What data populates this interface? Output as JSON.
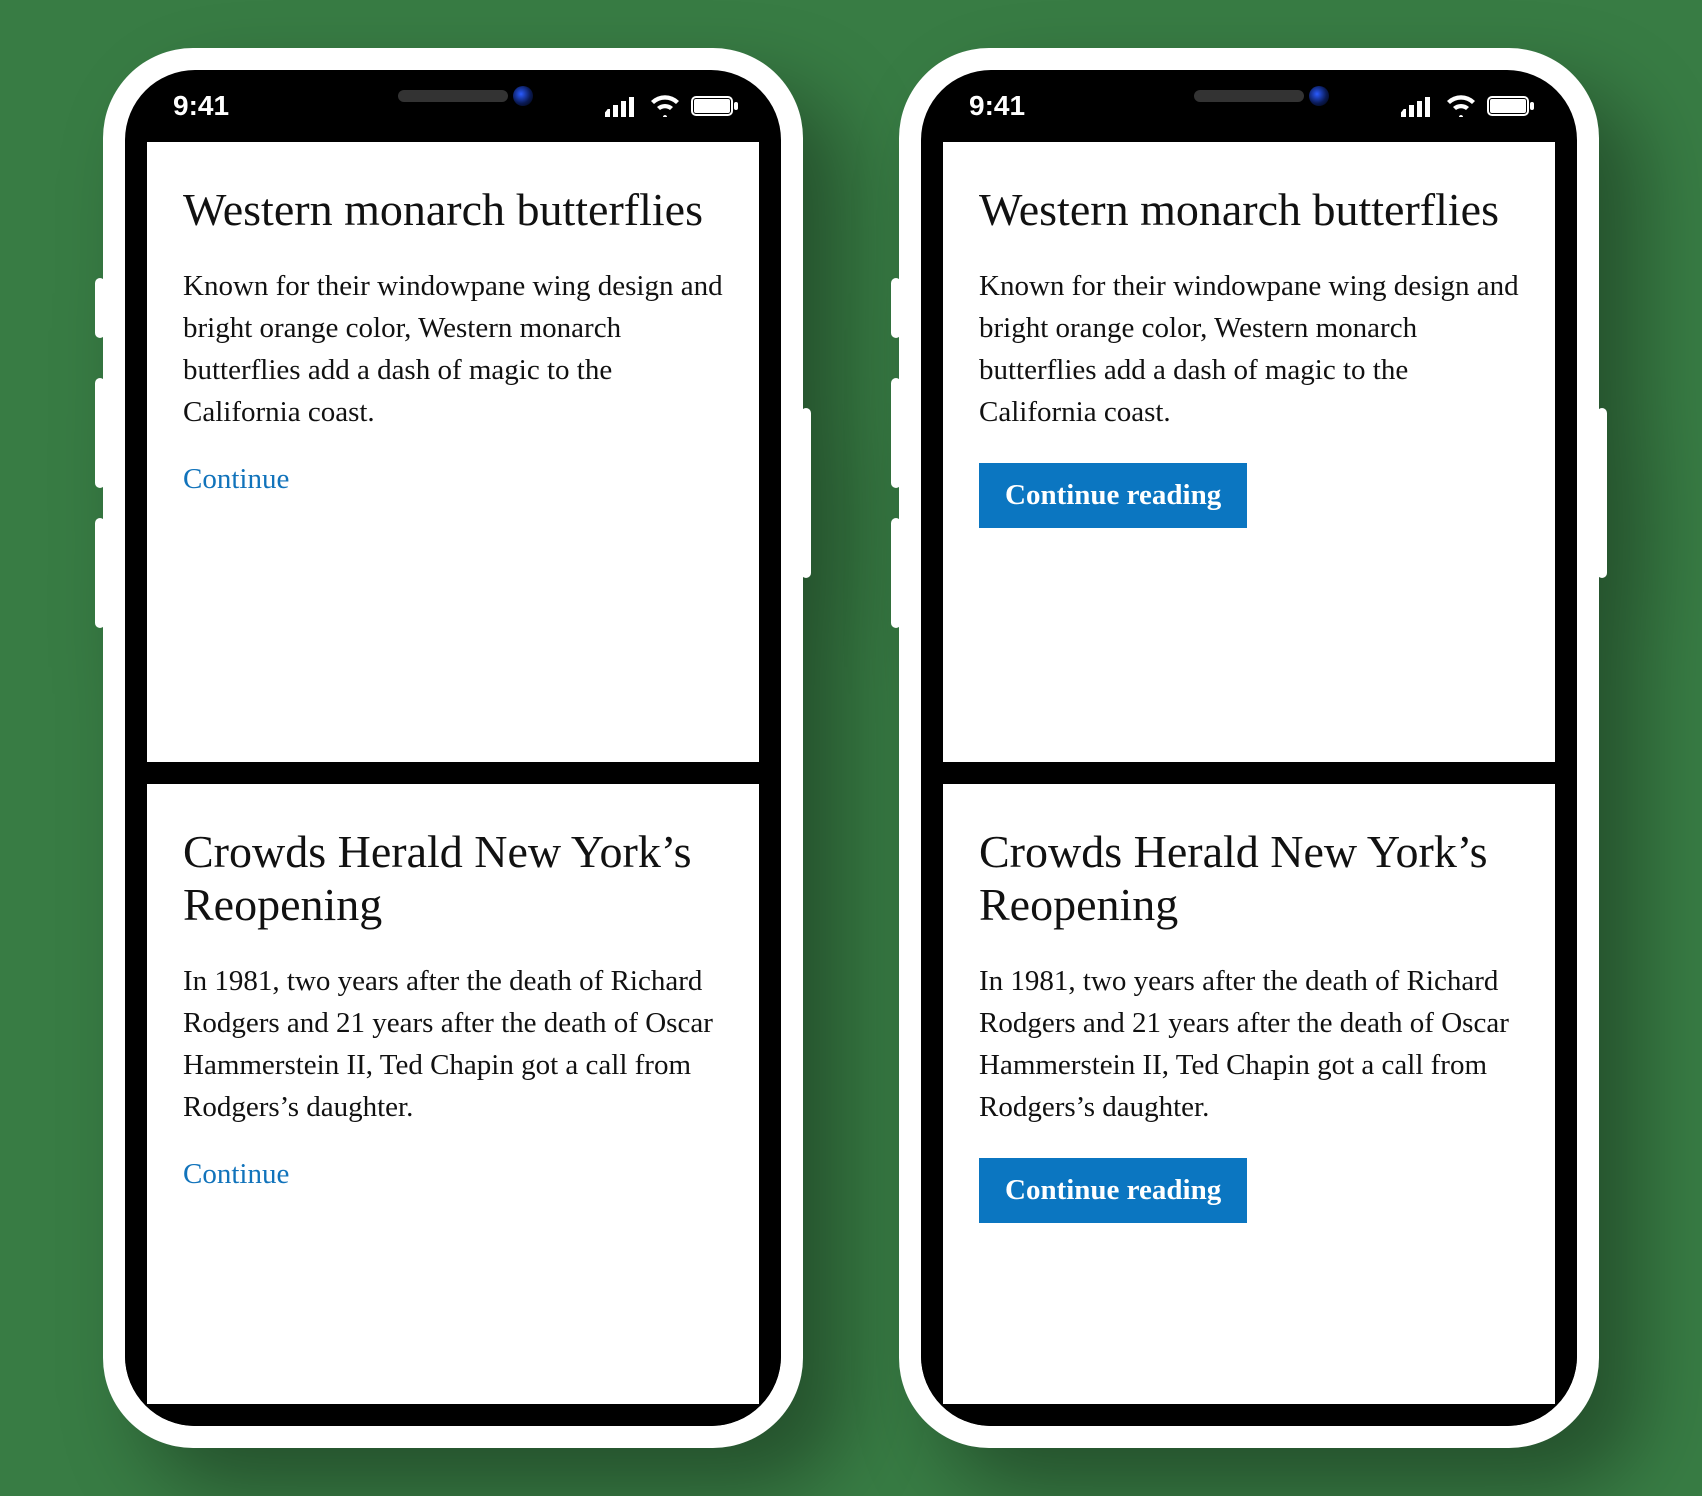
{
  "status_bar": {
    "time": "9:41"
  },
  "phone_a": {
    "cta_style": "link",
    "cards": [
      {
        "title": "Western monarch butterflies",
        "body": "Known for their windowpane wing design and bright orange color, Western monarch butterflies add a dash of magic to the California coast.",
        "cta": "Continue"
      },
      {
        "title": "Crowds Herald New York’s Reopening",
        "body": "In 1981, two years after the death of Richard Rodgers and 21 years after the death of Oscar Hammerstein II, Ted Chapin got a call from Rodgers’s daughter.",
        "cta": "Continue"
      }
    ]
  },
  "phone_b": {
    "cta_style": "button",
    "cards": [
      {
        "title": "Western monarch butterflies",
        "body": "Known for their windowpane wing design and bright orange color, Western monarch butterflies add a dash of magic to the California coast.",
        "cta": "Continue reading"
      },
      {
        "title": "Crowds Herald New York’s Reopening",
        "body": "In 1981, two years after the death of Richard Rodgers and 21 years after the death of Oscar Hammerstein II, Ted Chapin got a call from Rodgers’s daughter.",
        "cta": "Continue reading"
      }
    ]
  },
  "colors": {
    "background": "#387c44",
    "link": "#1173bb",
    "button_bg": "#0b76c1",
    "button_fg": "#ffffff"
  }
}
